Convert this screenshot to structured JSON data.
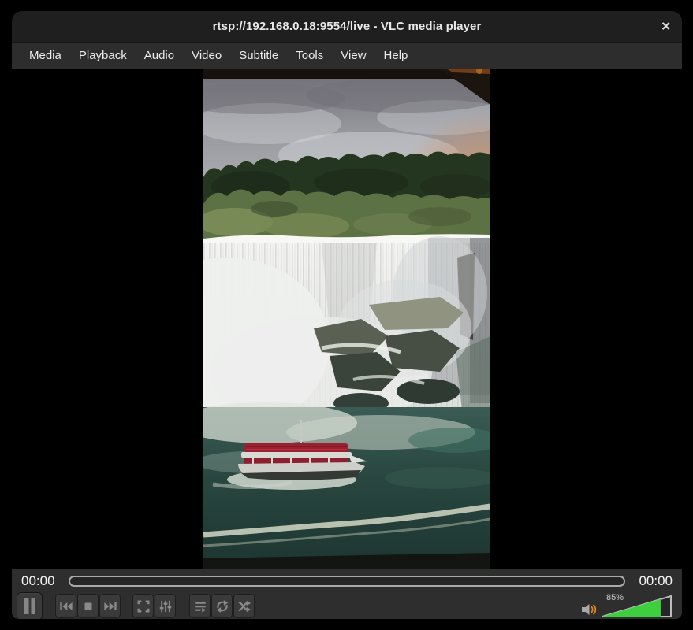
{
  "window": {
    "title": "rtsp://192.168.0.18:9554/live - VLC media player",
    "close_label": "✕"
  },
  "menu": {
    "items": [
      {
        "label": "Media"
      },
      {
        "label": "Playback"
      },
      {
        "label": "Audio"
      },
      {
        "label": "Video"
      },
      {
        "label": "Subtitle"
      },
      {
        "label": "Tools"
      },
      {
        "label": "View"
      },
      {
        "label": "Help"
      }
    ]
  },
  "seekbar": {
    "elapsed": "00:00",
    "remaining": "00:00",
    "progress_percent": 0
  },
  "controls": {
    "buttons": [
      {
        "id": "pause",
        "icon": "pause-icon"
      },
      {
        "id": "previous",
        "icon": "previous-icon"
      },
      {
        "id": "stop",
        "icon": "stop-icon"
      },
      {
        "id": "next",
        "icon": "next-icon"
      },
      {
        "id": "fullscreen",
        "icon": "fullscreen-icon"
      },
      {
        "id": "extended-settings",
        "icon": "equalizer-icon"
      },
      {
        "id": "playlist",
        "icon": "playlist-icon"
      },
      {
        "id": "loop",
        "icon": "loop-icon"
      },
      {
        "id": "random",
        "icon": "shuffle-icon"
      }
    ]
  },
  "volume": {
    "percent": 85,
    "percent_label": "85%"
  },
  "colors": {
    "titlebar_bg": "#1f1f1f",
    "menubar_bg": "#2d2d2d",
    "controlbar_bg": "#2e2e2e",
    "button_bg": "#3a3a3a",
    "icon_gray": "#8a8a8a",
    "volume_fill_green": "#3ecf3e",
    "speaker_orange": "#e0861c"
  }
}
